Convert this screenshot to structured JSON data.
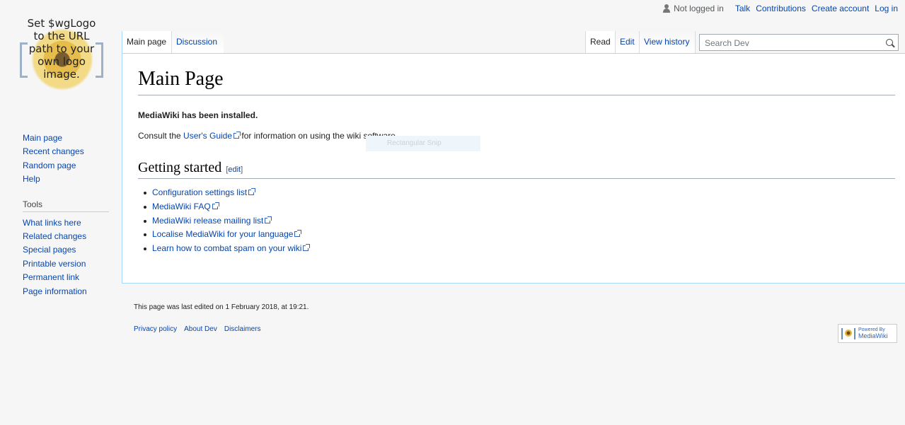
{
  "personal": {
    "not_logged_in": "Not logged in",
    "talk": "Talk",
    "contributions": "Contributions",
    "create_account": "Create account",
    "log_in": "Log in"
  },
  "logo": {
    "lines": [
      "Set $wgLogo",
      "to the URL",
      "path to your",
      "own logo",
      "image."
    ]
  },
  "sidebar": {
    "navigation": [
      "Main page",
      "Recent changes",
      "Random page",
      "Help"
    ],
    "tools_heading": "Tools",
    "tools": [
      "What links here",
      "Related changes",
      "Special pages",
      "Printable version",
      "Permanent link",
      "Page information"
    ]
  },
  "tabs": {
    "main_page": "Main page",
    "discussion": "Discussion",
    "read": "Read",
    "edit": "Edit",
    "view_history": "View history"
  },
  "search": {
    "placeholder": "Search Dev"
  },
  "content": {
    "title": "Main Page",
    "installed": "MediaWiki has been installed.",
    "consult_before": "Consult the ",
    "consult_link": "User's Guide",
    "consult_after": " for information on using the wiki software.",
    "snip_overlay": "Rectangular Snip",
    "section_heading": "Getting started",
    "section_edit": "[edit]",
    "links": [
      "Configuration settings list",
      "MediaWiki FAQ",
      "MediaWiki release mailing list",
      "Localise MediaWiki for your language",
      "Learn how to combat spam on your wiki"
    ]
  },
  "footer": {
    "last_edited": "This page was last edited on 1 February 2018, at 19:21.",
    "privacy": "Privacy policy",
    "about": "About Dev",
    "disclaimers": "Disclaimers",
    "powered_small": "Powered By",
    "powered_big": "MediaWiki"
  },
  "colors": {
    "link": "#0645ad",
    "border_blue": "#a7d7f9",
    "background": "#f6f6f6"
  }
}
